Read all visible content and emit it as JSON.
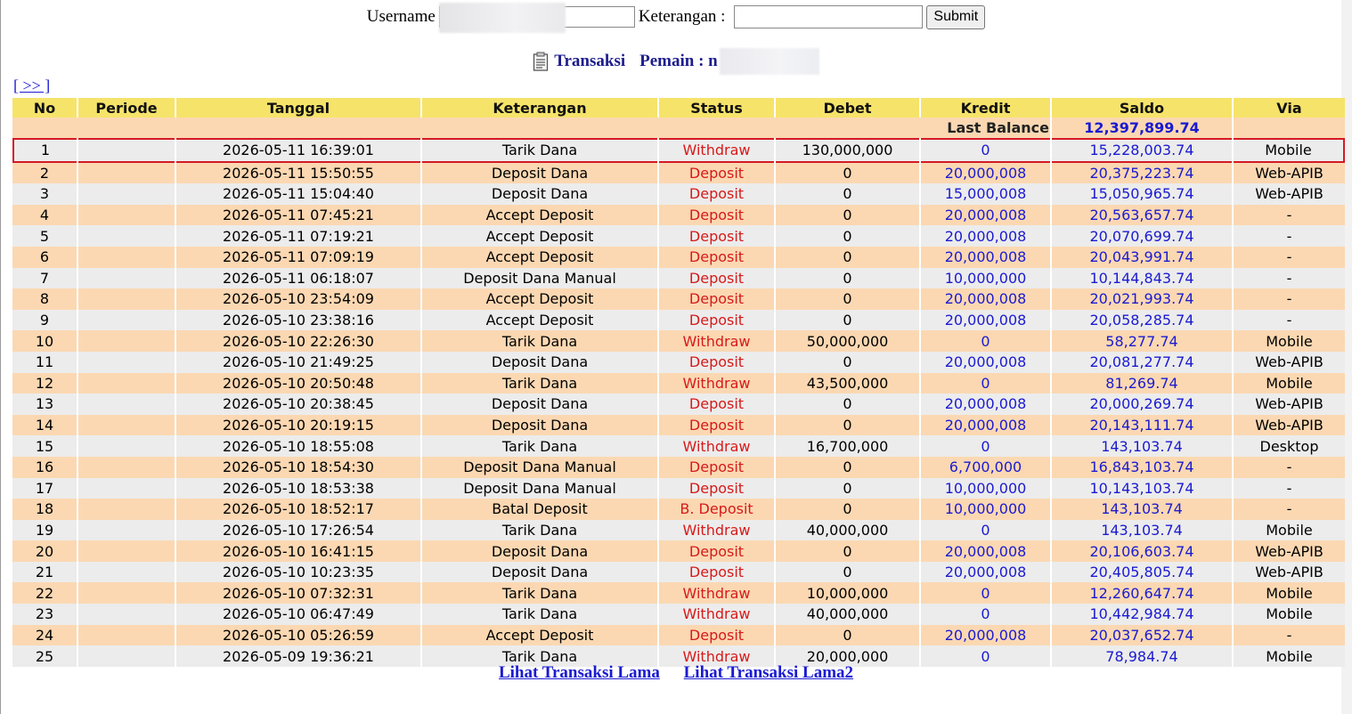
{
  "form": {
    "username_label": "Username",
    "username_value": "",
    "keterangan_label": "Keterangan :",
    "keterangan_value": "",
    "submit_label": "Submit"
  },
  "title": {
    "transaksi": "Transaksi",
    "pemain_label": "Pemain : n"
  },
  "nav_link": "[ >> ]",
  "table": {
    "headers": [
      "No",
      "Periode",
      "Tanggal",
      "Keterangan",
      "Status",
      "Debet",
      "Kredit",
      "Saldo",
      "Via"
    ],
    "last_balance_label": "Last Balance",
    "last_balance_value": "12,397,899.74",
    "rows": [
      {
        "no": "1",
        "periode": "",
        "tanggal": "2026-05-11 16:39:01",
        "keterangan": "Tarik Dana",
        "status": "Withdraw",
        "debet": "130,000,000",
        "kredit": "0",
        "saldo": "15,228,003.74",
        "via": "Mobile"
      },
      {
        "no": "2",
        "periode": "",
        "tanggal": "2026-05-11 15:50:55",
        "keterangan": "Deposit Dana",
        "status": "Deposit",
        "debet": "0",
        "kredit": "20,000,008",
        "saldo": "20,375,223.74",
        "via": "Web-APIB"
      },
      {
        "no": "3",
        "periode": "",
        "tanggal": "2026-05-11 15:04:40",
        "keterangan": "Deposit Dana",
        "status": "Deposit",
        "debet": "0",
        "kredit": "15,000,008",
        "saldo": "15,050,965.74",
        "via": "Web-APIB"
      },
      {
        "no": "4",
        "periode": "",
        "tanggal": "2026-05-11 07:45:21",
        "keterangan": "Accept Deposit",
        "status": "Deposit",
        "debet": "0",
        "kredit": "20,000,008",
        "saldo": "20,563,657.74",
        "via": "-"
      },
      {
        "no": "5",
        "periode": "",
        "tanggal": "2026-05-11 07:19:21",
        "keterangan": "Accept Deposit",
        "status": "Deposit",
        "debet": "0",
        "kredit": "20,000,008",
        "saldo": "20,070,699.74",
        "via": "-"
      },
      {
        "no": "6",
        "periode": "",
        "tanggal": "2026-05-11 07:09:19",
        "keterangan": "Accept Deposit",
        "status": "Deposit",
        "debet": "0",
        "kredit": "20,000,008",
        "saldo": "20,043,991.74",
        "via": "-"
      },
      {
        "no": "7",
        "periode": "",
        "tanggal": "2026-05-11 06:18:07",
        "keterangan": "Deposit Dana Manual",
        "status": "Deposit",
        "debet": "0",
        "kredit": "10,000,000",
        "saldo": "10,144,843.74",
        "via": "-"
      },
      {
        "no": "8",
        "periode": "",
        "tanggal": "2026-05-10 23:54:09",
        "keterangan": "Accept Deposit",
        "status": "Deposit",
        "debet": "0",
        "kredit": "20,000,008",
        "saldo": "20,021,993.74",
        "via": "-"
      },
      {
        "no": "9",
        "periode": "",
        "tanggal": "2026-05-10 23:38:16",
        "keterangan": "Accept Deposit",
        "status": "Deposit",
        "debet": "0",
        "kredit": "20,000,008",
        "saldo": "20,058,285.74",
        "via": "-"
      },
      {
        "no": "10",
        "periode": "",
        "tanggal": "2026-05-10 22:26:30",
        "keterangan": "Tarik Dana",
        "status": "Withdraw",
        "debet": "50,000,000",
        "kredit": "0",
        "saldo": "58,277.74",
        "via": "Mobile"
      },
      {
        "no": "11",
        "periode": "",
        "tanggal": "2026-05-10 21:49:25",
        "keterangan": "Deposit Dana",
        "status": "Deposit",
        "debet": "0",
        "kredit": "20,000,008",
        "saldo": "20,081,277.74",
        "via": "Web-APIB"
      },
      {
        "no": "12",
        "periode": "",
        "tanggal": "2026-05-10 20:50:48",
        "keterangan": "Tarik Dana",
        "status": "Withdraw",
        "debet": "43,500,000",
        "kredit": "0",
        "saldo": "81,269.74",
        "via": "Mobile"
      },
      {
        "no": "13",
        "periode": "",
        "tanggal": "2026-05-10 20:38:45",
        "keterangan": "Deposit Dana",
        "status": "Deposit",
        "debet": "0",
        "kredit": "20,000,008",
        "saldo": "20,000,269.74",
        "via": "Web-APIB"
      },
      {
        "no": "14",
        "periode": "",
        "tanggal": "2026-05-10 20:19:15",
        "keterangan": "Deposit Dana",
        "status": "Deposit",
        "debet": "0",
        "kredit": "20,000,008",
        "saldo": "20,143,111.74",
        "via": "Web-APIB"
      },
      {
        "no": "15",
        "periode": "",
        "tanggal": "2026-05-10 18:55:08",
        "keterangan": "Tarik Dana",
        "status": "Withdraw",
        "debet": "16,700,000",
        "kredit": "0",
        "saldo": "143,103.74",
        "via": "Desktop"
      },
      {
        "no": "16",
        "periode": "",
        "tanggal": "2026-05-10 18:54:30",
        "keterangan": "Deposit Dana Manual",
        "status": "Deposit",
        "debet": "0",
        "kredit": "6,700,000",
        "saldo": "16,843,103.74",
        "via": "-"
      },
      {
        "no": "17",
        "periode": "",
        "tanggal": "2026-05-10 18:53:38",
        "keterangan": "Deposit Dana Manual",
        "status": "Deposit",
        "debet": "0",
        "kredit": "10,000,000",
        "saldo": "10,143,103.74",
        "via": "-"
      },
      {
        "no": "18",
        "periode": "",
        "tanggal": "2026-05-10 18:52:17",
        "keterangan": "Batal Deposit",
        "status": "B. Deposit",
        "debet": "0",
        "kredit": "10,000,000",
        "saldo": "143,103.74",
        "via": "-"
      },
      {
        "no": "19",
        "periode": "",
        "tanggal": "2026-05-10 17:26:54",
        "keterangan": "Tarik Dana",
        "status": "Withdraw",
        "debet": "40,000,000",
        "kredit": "0",
        "saldo": "143,103.74",
        "via": "Mobile"
      },
      {
        "no": "20",
        "periode": "",
        "tanggal": "2026-05-10 16:41:15",
        "keterangan": "Deposit Dana",
        "status": "Deposit",
        "debet": "0",
        "kredit": "20,000,008",
        "saldo": "20,106,603.74",
        "via": "Web-APIB"
      },
      {
        "no": "21",
        "periode": "",
        "tanggal": "2026-05-10 10:23:35",
        "keterangan": "Deposit Dana",
        "status": "Deposit",
        "debet": "0",
        "kredit": "20,000,008",
        "saldo": "20,405,805.74",
        "via": "Web-APIB"
      },
      {
        "no": "22",
        "periode": "",
        "tanggal": "2026-05-10 07:32:31",
        "keterangan": "Tarik Dana",
        "status": "Withdraw",
        "debet": "10,000,000",
        "kredit": "0",
        "saldo": "12,260,647.74",
        "via": "Mobile"
      },
      {
        "no": "23",
        "periode": "",
        "tanggal": "2026-05-10 06:47:49",
        "keterangan": "Tarik Dana",
        "status": "Withdraw",
        "debet": "40,000,000",
        "kredit": "0",
        "saldo": "10,442,984.74",
        "via": "Mobile"
      },
      {
        "no": "24",
        "periode": "",
        "tanggal": "2026-05-10 05:26:59",
        "keterangan": "Accept Deposit",
        "status": "Deposit",
        "debet": "0",
        "kredit": "20,000,008",
        "saldo": "20,037,652.74",
        "via": "-"
      },
      {
        "no": "25",
        "periode": "",
        "tanggal": "2026-05-09 19:36:21",
        "keterangan": "Tarik Dana",
        "status": "Withdraw",
        "debet": "20,000,000",
        "kredit": "0",
        "saldo": "78,984.74",
        "via": "Mobile"
      }
    ]
  },
  "bottom_links": [
    "Lihat Transaksi Lama",
    "Lihat Transaksi Lama2"
  ],
  "colors": {
    "header_bg": "#f6e36a",
    "row_odd": "#ececec",
    "row_even": "#fbd8b2",
    "status_red": "#d71a1a",
    "link_blue": "#1a1ad2",
    "highlight_border": "#d41a24"
  },
  "icons": {
    "title_icon": "clipboard-icon"
  }
}
